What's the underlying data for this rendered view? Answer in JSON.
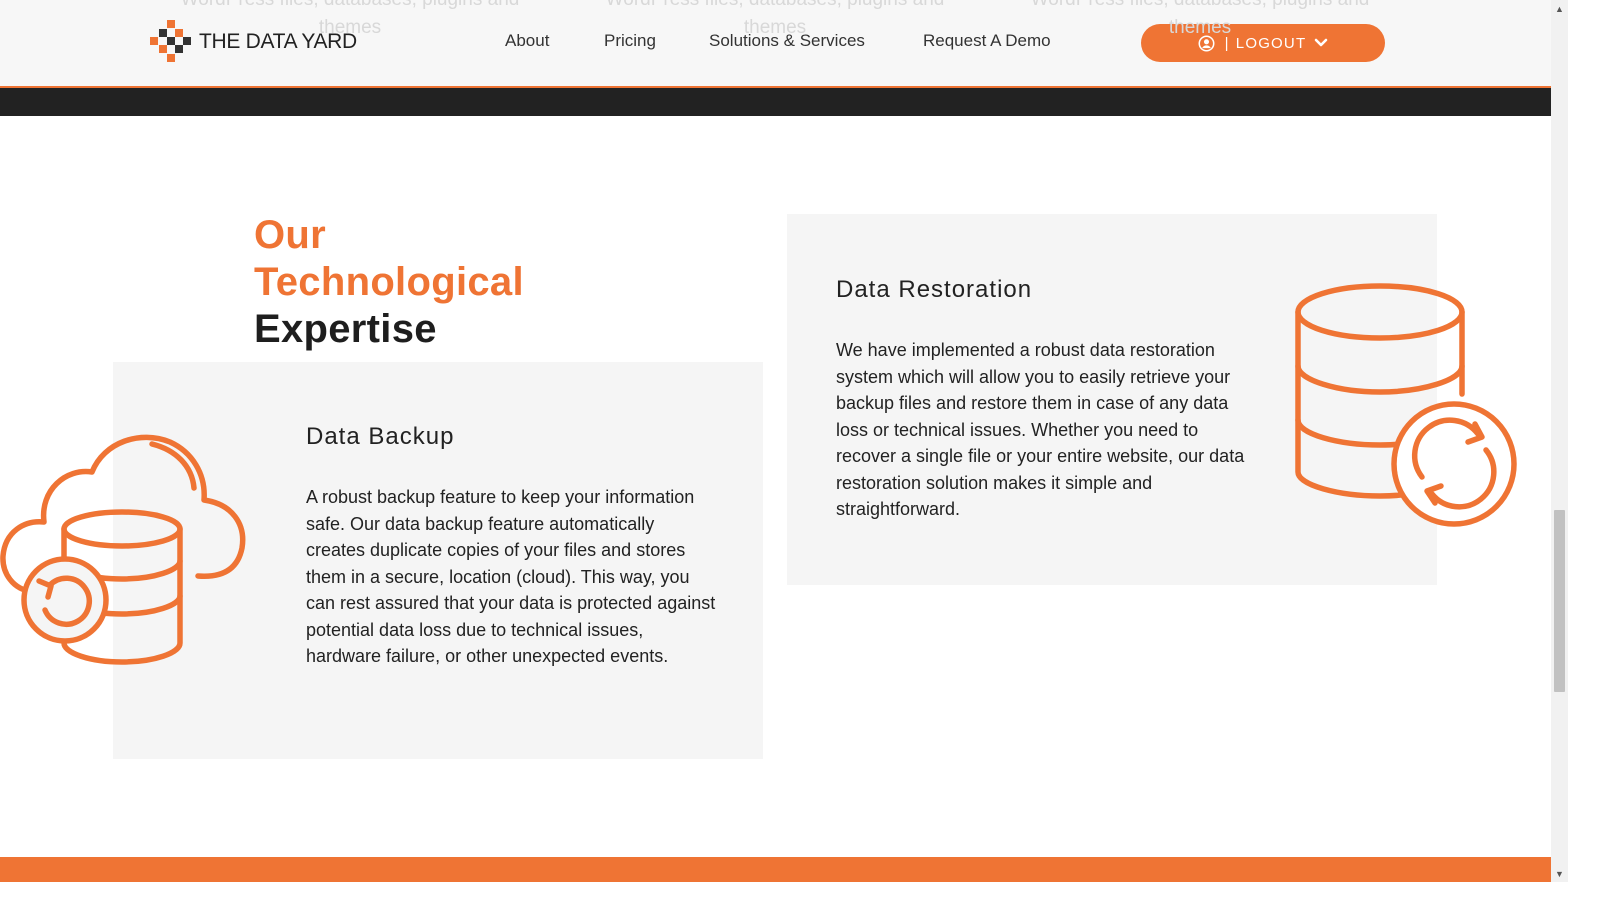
{
  "header": {
    "brand": "THE DATA YARD",
    "nav": [
      {
        "label": "About"
      },
      {
        "label": "Pricing"
      },
      {
        "label": "Solutions & Services"
      },
      {
        "label": "Request A Demo"
      }
    ],
    "logout_button": {
      "label": "LOGOUT",
      "separator": "|",
      "icon": "user-circle-icon",
      "caret": "chevron-down-icon"
    }
  },
  "ghost_text": [
    "WordPress files, databases, plugins and themes",
    "WordPress files, databases, plugins and themes",
    "WordPress files, databases, plugins and themes"
  ],
  "section": {
    "heading_line1": "Our",
    "heading_line2": "Technological",
    "heading_line3": "Expertise"
  },
  "cards": {
    "backup": {
      "title": "Data Backup",
      "text": "A robust backup feature to keep your information safe. Our data backup feature automatically creates duplicate copies of your files and stores them in a secure, location (cloud). This way, you can rest assured that your data is protected against potential data loss due to technical issues, hardware failure, or other unexpected events.",
      "icon": "cloud-database-backup-icon"
    },
    "restore": {
      "title": "Data Restoration",
      "text": "We have implemented a robust data restoration system which will allow you to easily retrieve your backup files and restore them in case of any data loss or technical issues. Whether you need to recover a single file or your entire website, our data restoration solution makes it simple and straightforward.",
      "icon": "database-restore-icon"
    }
  },
  "colors": {
    "accent": "#ef7434",
    "dark": "#222222",
    "card_bg": "#f5f5f5"
  }
}
